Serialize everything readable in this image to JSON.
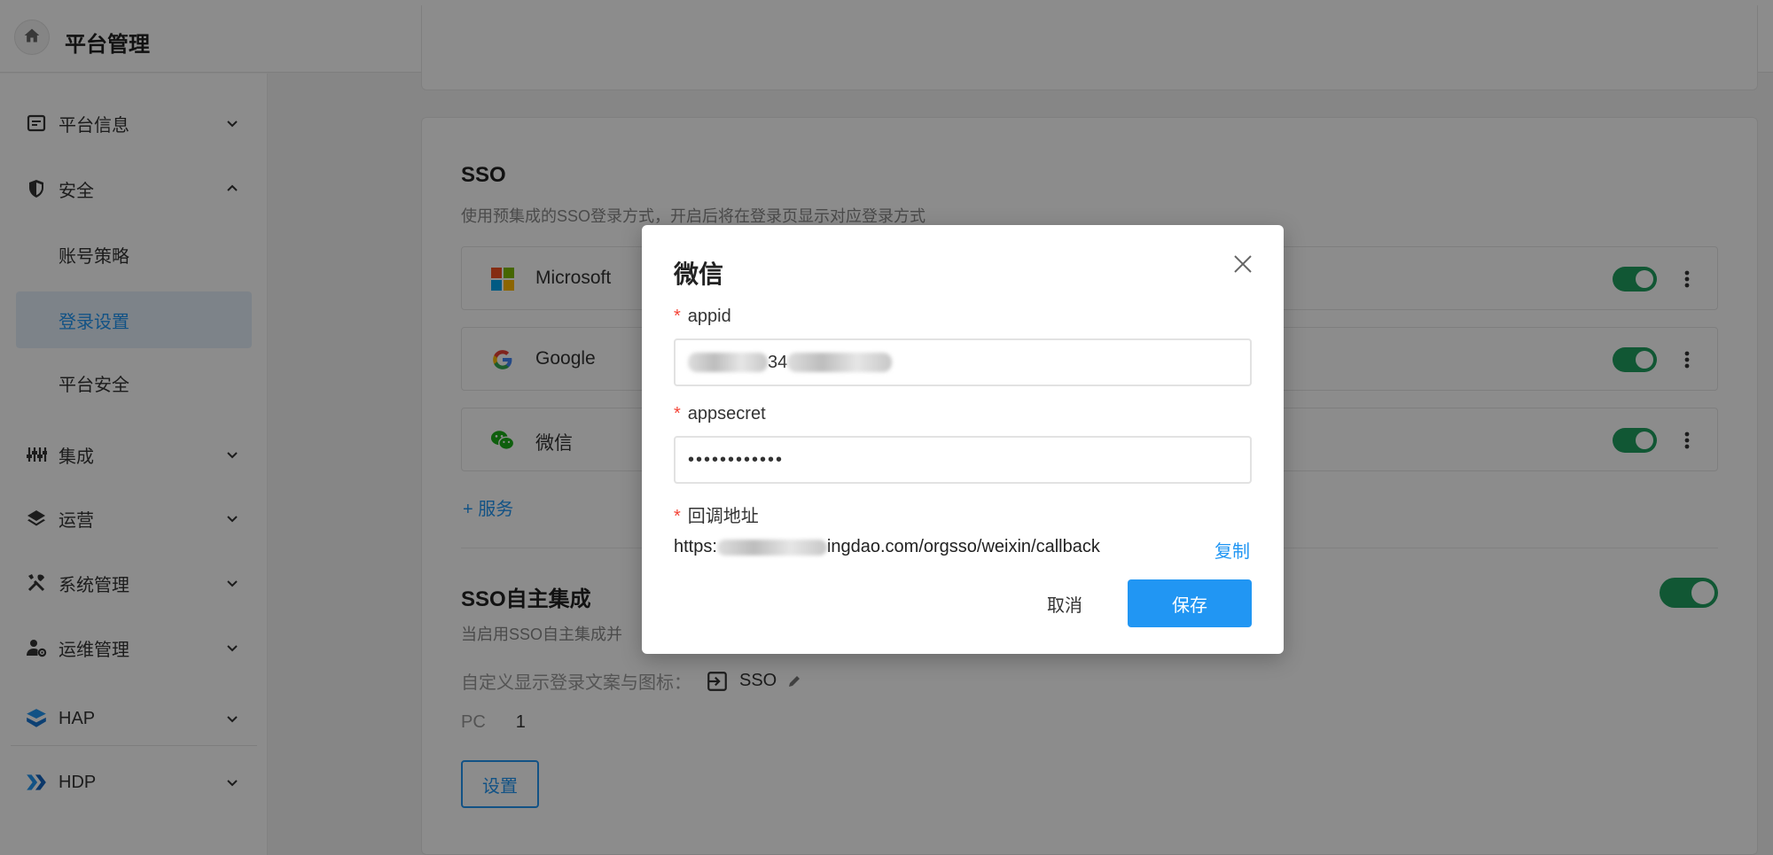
{
  "header": {
    "title": "平台管理",
    "home_icon": "home-icon"
  },
  "sidebar": {
    "items": [
      {
        "label": "平台信息",
        "icon": "info-card-icon"
      },
      {
        "label": "安全",
        "icon": "shield-icon"
      },
      {
        "label": "集成",
        "icon": "sliders-icon"
      },
      {
        "label": "运营",
        "icon": "layers-icon"
      },
      {
        "label": "系统管理",
        "icon": "tools-icon"
      },
      {
        "label": "运维管理",
        "icon": "user-gear-icon"
      },
      {
        "label": "HAP",
        "icon": "hap-logo-icon"
      },
      {
        "label": "HDP",
        "icon": "hdp-logo-icon"
      }
    ],
    "security_sub": [
      {
        "label": "账号策略"
      },
      {
        "label": "登录设置",
        "active": true
      },
      {
        "label": "平台安全"
      }
    ]
  },
  "main": {
    "sso_title": "SSO",
    "sso_desc": "使用预集成的SSO登录方式，开启后将在登录页显示对应登录方式",
    "sso_providers": [
      {
        "name": "Microsoft",
        "enabled": true
      },
      {
        "name": "Google",
        "enabled": true
      },
      {
        "name": "微信",
        "enabled": true
      }
    ],
    "add_service": "+ 服务",
    "self_title": "SSO自主集成",
    "self_desc": "当启用SSO自主集成并",
    "custom_label": "自定义显示登录文案与图标：",
    "custom_value": "SSO",
    "pc_label": "PC",
    "pc_value": "1",
    "settings_button": "设置"
  },
  "modal": {
    "title": "微信",
    "appid_label": "appid",
    "appid_visible": "34",
    "appsecret_label": "appsecret",
    "appsecret_value": "••••••••••••",
    "callback_label": "回调地址",
    "callback_prefix": "https:",
    "callback_suffix": "ingdao.com/orgsso/weixin/callback",
    "copy": "复制",
    "cancel": "取消",
    "save": "保存"
  },
  "colors": {
    "accent": "#2196f3",
    "toggle_on": "#1f9e5f",
    "required": "#f44336",
    "active_bg": "#e3eef9"
  }
}
